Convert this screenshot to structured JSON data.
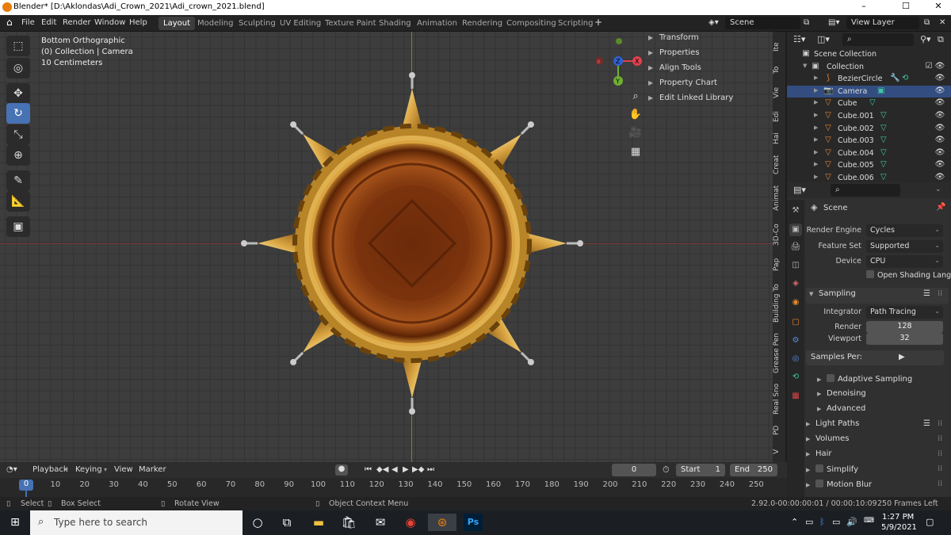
{
  "window": {
    "title": "Blender* [D:\\Aklondas\\Adi_Crown_2021\\Adi_crown_2021.blend]",
    "controls": [
      "–",
      "☐",
      "✕"
    ]
  },
  "menu": {
    "items": [
      "File",
      "Edit",
      "Render",
      "Window",
      "Help"
    ]
  },
  "workspaces": [
    "Layout",
    "Modeling",
    "Sculpting",
    "UV Editing",
    "Texture Paint",
    "Shading",
    "Animation",
    "Rendering",
    "Compositing",
    "Scripting"
  ],
  "scene_field": "Scene",
  "view_layer_field": "View Layer",
  "viewport": {
    "view_name": "Bottom Orthographic",
    "collection_info": "(0) Collection | Camera",
    "scale_info": "10 Centimeters",
    "axes": {
      "z": "Z",
      "x": "X",
      "y": "Y"
    }
  },
  "npanel": [
    "Transform",
    "Properties",
    "Align Tools",
    "Property Chart",
    "Edit Linked Library"
  ],
  "side_tabs": [
    "Ite",
    "To",
    "Vie",
    "Edi",
    "Hai",
    "Creat",
    "Animat",
    "3D-Co",
    "Pap",
    "Building To",
    "Grease Pen",
    "Real Sno",
    "PD",
    "V"
  ],
  "outliner": {
    "root": "Scene Collection",
    "collection": "Collection",
    "items": [
      "BezierCircle",
      "Camera",
      "Cube",
      "Cube.001",
      "Cube.002",
      "Cube.003",
      "Cube.004",
      "Cube.005",
      "Cube.006"
    ],
    "selected": "Camera"
  },
  "properties": {
    "context": "Scene",
    "render_engine": {
      "label": "Render Engine",
      "value": "Cycles"
    },
    "feature_set": {
      "label": "Feature Set",
      "value": "Supported"
    },
    "device": {
      "label": "Device",
      "value": "CPU"
    },
    "osl": "Open Shading Lang...",
    "sampling": "Sampling",
    "integrator": {
      "label": "Integrator",
      "value": "Path Tracing"
    },
    "render_samples": {
      "label": "Render",
      "value": "128"
    },
    "viewport_samples": {
      "label": "Viewport",
      "value": "32"
    },
    "samples_per": "Samples Per:",
    "adaptive": "Adaptive Sampling",
    "denoising": "Denoising",
    "advanced": "Advanced",
    "sections": [
      "Light Paths",
      "Volumes",
      "Hair",
      "Simplify",
      "Motion Blur"
    ]
  },
  "timeline": {
    "menus": [
      "Playback",
      "Keying",
      "View",
      "Marker"
    ],
    "current": "0",
    "start_label": "Start",
    "start": "1",
    "end_label": "End",
    "end": "250",
    "ticks": [
      "0",
      "10",
      "20",
      "30",
      "40",
      "50",
      "60",
      "70",
      "80",
      "90",
      "100",
      "110",
      "120",
      "130",
      "140",
      "150",
      "160",
      "170",
      "180",
      "190",
      "200",
      "210",
      "220",
      "230",
      "240",
      "250"
    ]
  },
  "status": {
    "select": "Select",
    "box_select": "Box Select",
    "rotate": "Rotate View",
    "context_menu": "Object Context Menu",
    "version": "2.92.0",
    "time": "-00:00:00:01 / 00:00:10:09",
    "frames_left": "250 Frames Left"
  },
  "taskbar": {
    "search_placeholder": "Type here to search",
    "time": "1:27 PM",
    "date": "5/9/2021"
  },
  "colors": {
    "accent": "#4772b3",
    "bg": "#3d3d3d",
    "gold": "#d9a441"
  }
}
